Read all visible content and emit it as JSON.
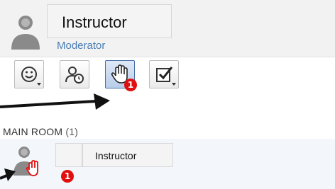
{
  "user": {
    "name": "Instructor",
    "role": "Moderator"
  },
  "toolbar": {
    "buttons": [
      {
        "icon": "emoticon-icon",
        "active": false
      },
      {
        "icon": "user-clock-icon",
        "active": false
      },
      {
        "icon": "raise-hand-icon",
        "active": true,
        "badge": "1"
      },
      {
        "icon": "checkbox-icon",
        "active": false
      }
    ]
  },
  "room": {
    "title": "MAIN ROOM",
    "count": "(1)",
    "participants": [
      {
        "name": "Instructor",
        "status_icon": "raised-hand-icon",
        "badge": "1"
      }
    ]
  },
  "colors": {
    "accent": "#4a7db3",
    "badge": "#e01010",
    "active_button": "#b7cdea"
  }
}
